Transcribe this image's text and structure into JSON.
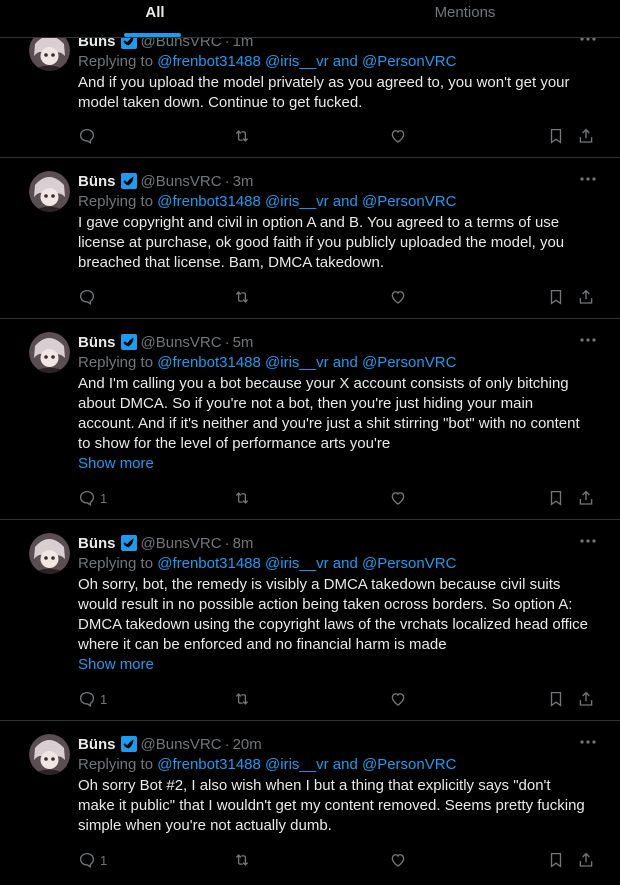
{
  "tabs": [
    {
      "label": "All",
      "active": true
    },
    {
      "label": "Mentions",
      "active": false
    }
  ],
  "reply_prefix": "Replying to",
  "show_more_label": "Show more",
  "colors": {
    "accent": "#1d9bf0",
    "muted": "#71767b",
    "text": "#e7e9ea",
    "border": "#2f3336",
    "background": "#000000"
  },
  "tweets": [
    {
      "name": "Büns",
      "handle": "@BunsVRC",
      "dot": "·",
      "time": "1m",
      "mentions": [
        "@frenbot31488",
        "@iris__vr",
        "and",
        "@PersonVRC"
      ],
      "text": "And if you upload the model privately as you agreed to, you won't get your model taken down. Continue to get fucked.",
      "show_more": false,
      "reply_count": ""
    },
    {
      "name": "Büns",
      "handle": "@BunsVRC",
      "dot": "·",
      "time": "3m",
      "mentions": [
        "@frenbot31488",
        "@iris__vr",
        "and",
        "@PersonVRC"
      ],
      "text": "I gave copyright and civil in option A and B. You agreed to a terms of use license at purchase, ok good faith if you publicly uploaded the model, you breached that license. Bam, DMCA takedown.",
      "show_more": false,
      "reply_count": ""
    },
    {
      "name": "Büns",
      "handle": "@BunsVRC",
      "dot": "·",
      "time": "5m",
      "mentions": [
        "@frenbot31488",
        "@iris__vr",
        "and",
        "@PersonVRC"
      ],
      "text": "And I'm calling you a bot because your X account consists of only bitching about DMCA. So if you're not a bot, then you're just hiding your main account. And if it's neither and you're just a shit stirring \"bot\" with no content to show for the level of performance arts you're",
      "show_more": true,
      "reply_count": "1"
    },
    {
      "name": "Büns",
      "handle": "@BunsVRC",
      "dot": "·",
      "time": "8m",
      "mentions": [
        "@frenbot31488",
        "@iris__vr",
        "and",
        "@PersonVRC"
      ],
      "text": "Oh sorry, bot, the remedy is visibly a DMCA takedown because civil suits would result in no possible action being taken ocross borders. So option A: DMCA takedown using the copyright laws of the vrchats localized head office where it can be enforced and no financial harm is made",
      "show_more": true,
      "reply_count": "1"
    },
    {
      "name": "Büns",
      "handle": "@BunsVRC",
      "dot": "·",
      "time": "20m",
      "mentions": [
        "@frenbot31488",
        "@iris__vr",
        "and",
        "@PersonVRC"
      ],
      "text": "Oh sorry Bot #2, I also wish when I but a thing that explicitly says \"don't make it public\" that I wouldn't get my content removed. Seems pretty fucking simple when you're not actually dumb.",
      "show_more": false,
      "reply_count": "1"
    }
  ]
}
